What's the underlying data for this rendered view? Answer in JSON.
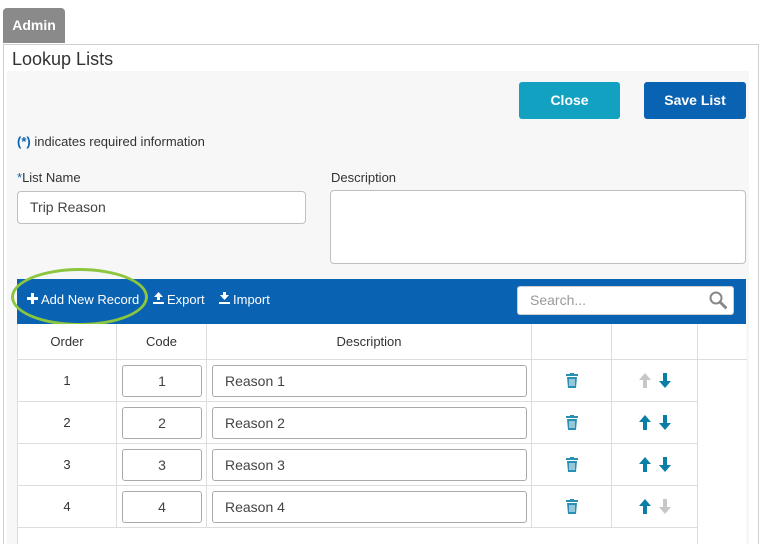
{
  "admin_tab": "Admin",
  "panel_title": "Lookup Lists",
  "buttons": {
    "close": "Close",
    "save_list": "Save List"
  },
  "required_note": {
    "marker": "(*)",
    "text": " indicates required information"
  },
  "fields": {
    "list_name": {
      "star": "*",
      "label": "List Name",
      "value": "Trip Reason"
    },
    "description": {
      "label": "Description",
      "value": ""
    }
  },
  "toolbar": {
    "add_new": "Add New Record",
    "export": "Export",
    "import": "Import",
    "search_placeholder": "Search..."
  },
  "table": {
    "headers": {
      "order": "Order",
      "code": "Code",
      "description": "Description"
    },
    "rows": [
      {
        "order": "1",
        "code": "1",
        "description": "Reason 1",
        "up_enabled": false,
        "down_enabled": true
      },
      {
        "order": "2",
        "code": "2",
        "description": "Reason 2",
        "up_enabled": true,
        "down_enabled": true
      },
      {
        "order": "3",
        "code": "3",
        "description": "Reason 3",
        "up_enabled": true,
        "down_enabled": true
      },
      {
        "order": "4",
        "code": "4",
        "description": "Reason 4",
        "up_enabled": true,
        "down_enabled": false
      }
    ]
  },
  "icons": {
    "add": "plus-icon",
    "export": "upload-icon",
    "import": "download-icon",
    "search": "search-icon",
    "delete": "trash-icon",
    "up": "arrow-up-icon",
    "down": "arrow-down-icon"
  },
  "colors": {
    "primary": "#0a62b2",
    "close_button": "#13a1c1",
    "highlight": "#8cc63f",
    "arrow_enabled": "#0a7fa6",
    "arrow_disabled": "#c7c7c7",
    "trash": "#2a8fb3"
  }
}
